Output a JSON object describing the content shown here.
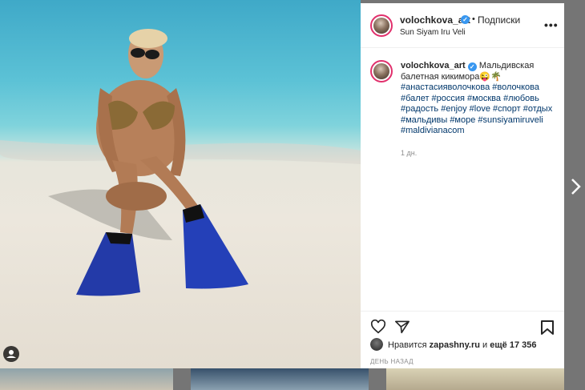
{
  "post": {
    "username": "volochkova_art",
    "follow_label": "Подписки",
    "separator": "•",
    "location": "Sun Siyam Iru Veli",
    "more_label": "•••"
  },
  "caption": {
    "username": "volochkova_art",
    "text": "Мальдивская балетная кикимора😜🌴",
    "hashtags": "#анастасияволочкова #волочкова #балет #россия #москва #любовь #радость #enjoy #love #спорт #отдых #мальдивы #море #sunsiyamiruveli #maldivianacom",
    "age": "1 дн."
  },
  "likes": {
    "prefix": "Нравится",
    "user": "zapashny.ru",
    "middle": "и",
    "count": "ещё 17 356"
  },
  "timestamp": "ДЕНЬ НАЗАД",
  "icons": [
    "heart-icon",
    "share-icon",
    "bookmark-icon",
    "chevron-right-icon",
    "user-tag-icon"
  ],
  "colors": {
    "ring": "#e1306c",
    "verified": "#3897f0",
    "hashtag": "#00376b"
  }
}
